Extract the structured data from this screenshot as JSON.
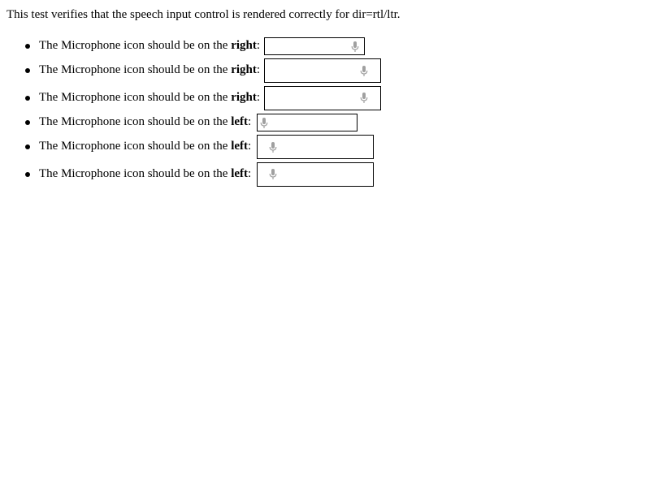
{
  "intro_text": "This test verifies that the speech input control is rendered correctly for dir=rtl/ltr.",
  "colors": {
    "text": "#000000",
    "field_border": "#000000",
    "mic_icon": "#a0a0a0"
  },
  "items": [
    {
      "prefix": "The Microphone icon should be on the ",
      "side": "right",
      "suffix": ":",
      "mic_icon": "microphone-icon"
    },
    {
      "prefix": "The Microphone icon should be on the ",
      "side": "right",
      "suffix": ":",
      "mic_icon": "microphone-icon"
    },
    {
      "prefix": "The Microphone icon should be on the ",
      "side": "right",
      "suffix": ":",
      "mic_icon": "microphone-icon"
    },
    {
      "prefix": "The Microphone icon should be on the ",
      "side": "left",
      "suffix": ":",
      "mic_icon": "microphone-icon"
    },
    {
      "prefix": "The Microphone icon should be on the ",
      "side": "left",
      "suffix": ":",
      "mic_icon": "microphone-icon"
    },
    {
      "prefix": "The Microphone icon should be on the ",
      "side": "left",
      "suffix": ":",
      "mic_icon": "microphone-icon"
    }
  ]
}
